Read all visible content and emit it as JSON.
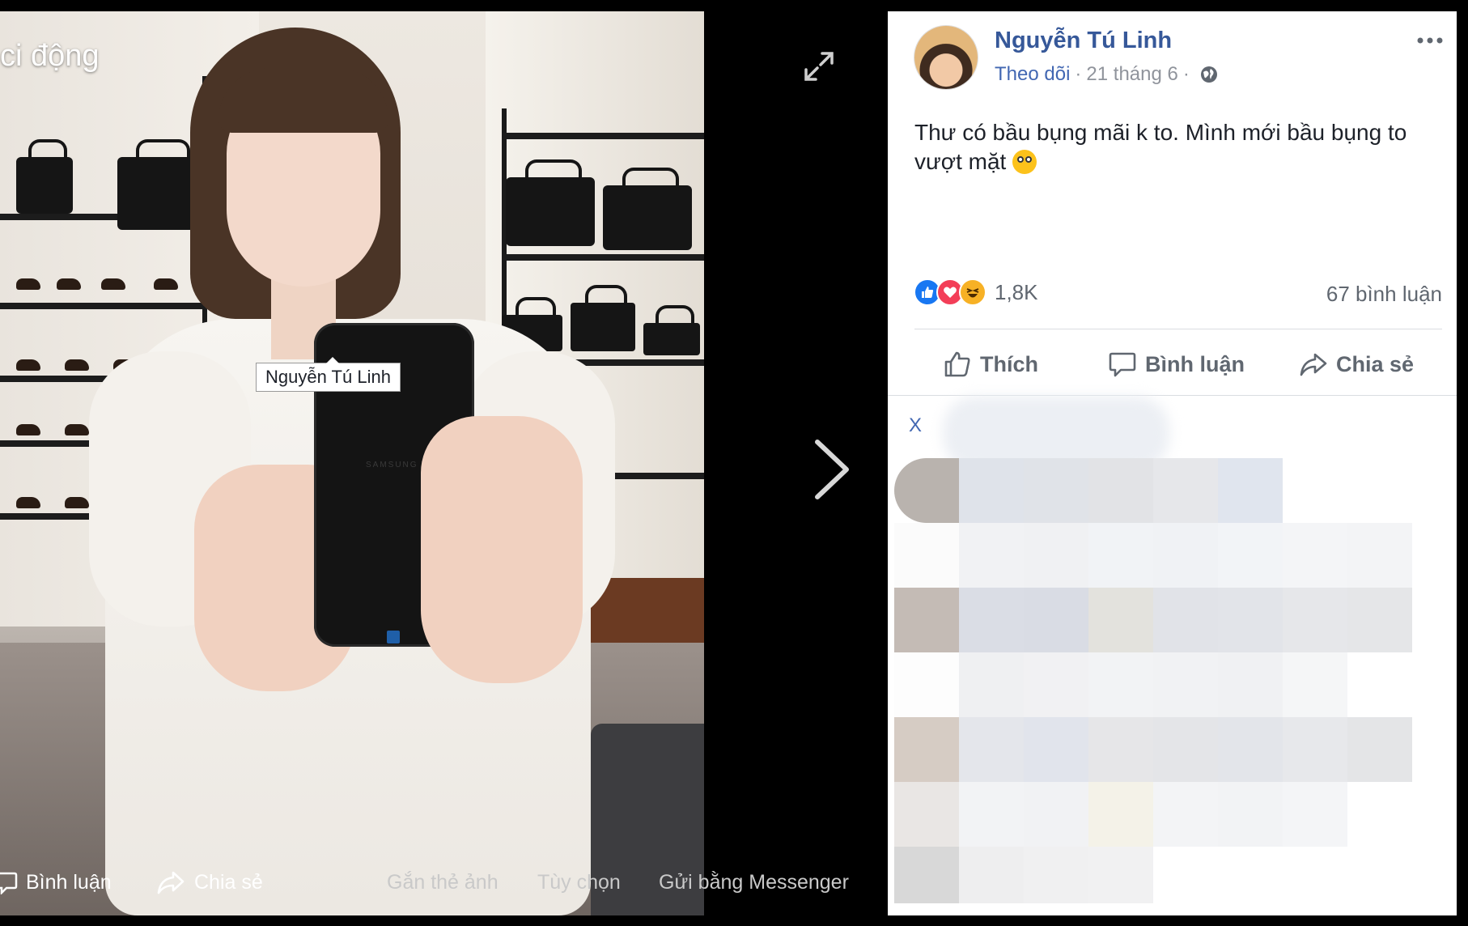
{
  "viewer": {
    "title_fragment": "ci động",
    "tag_label": "Nguyễn Tú Linh",
    "phone_brand": "SAMSUNG",
    "bottom_actions": [
      {
        "label": "Bình luận",
        "icon": "comment-icon"
      },
      {
        "label": "Chia sẻ",
        "icon": "share-icon"
      },
      {
        "label": "Gắn thẻ ảnh"
      },
      {
        "label": "Tùy chọn"
      },
      {
        "label": "Gửi bằng Messenger"
      }
    ],
    "icons": {
      "expand": "expand-icon",
      "next": "chevron-right-icon"
    }
  },
  "post": {
    "author": "Nguyễn Tú Linh",
    "follow_label": "Theo dõi",
    "date": "21 tháng 6",
    "dot": "·",
    "privacy_icon": "globe-icon",
    "text": "Thư có bầu bụng mãi k to. Mình mới bầu bụng to vượt mặt",
    "emoji": "flushed-face-emoji",
    "reaction_count": "1,8K",
    "reactions": [
      "like-reaction-icon",
      "love-reaction-icon",
      "haha-reaction-icon"
    ],
    "comment_count": "67 bình luận",
    "actions": [
      {
        "label": "Thích",
        "icon": "thumbs-up-icon"
      },
      {
        "label": "Bình luận",
        "icon": "comment-icon"
      },
      {
        "label": "Chia sẻ",
        "icon": "share-icon"
      }
    ],
    "see_more_fragment": "X"
  },
  "colors": {
    "link_blue": "#365899",
    "follow_blue": "#4267b2",
    "meta_gray": "#90949c",
    "text_dark": "#1d2129",
    "like_blue": "#1877f2",
    "love_red": "#f33e58",
    "haha_yellow": "#f7b125"
  }
}
